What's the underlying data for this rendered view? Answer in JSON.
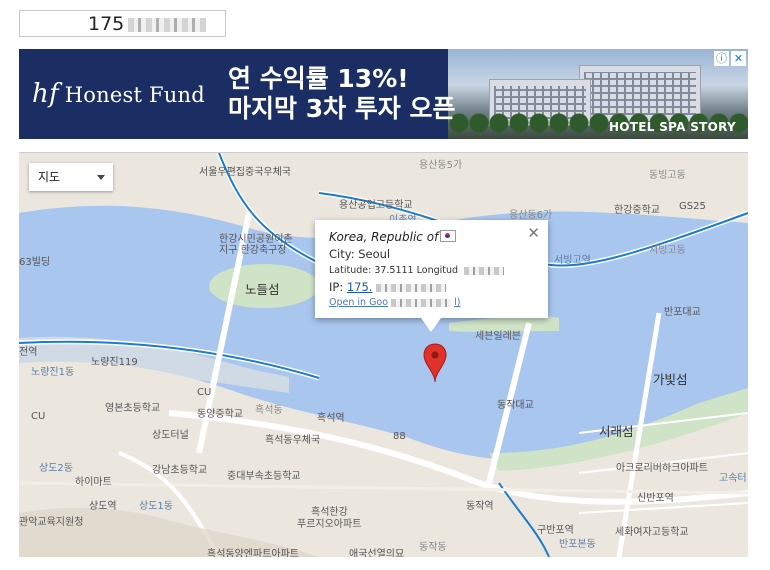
{
  "ip_input": {
    "value": "175",
    "masked_tail": "(blurred)"
  },
  "ad": {
    "brand": "Honest Fund",
    "brand_mark": "hf",
    "headline_line1": "연 수익률 13%!",
    "headline_line2": "마지막 3차 투자 오픈",
    "tagline": "HOTEL SPA STORY",
    "info_icon": "info-icon",
    "close_icon": "close-icon"
  },
  "map": {
    "type_select": "지도",
    "info": {
      "country": "Korea, Republic of",
      "city": "City: Seoul",
      "coords": "Latitude: 37.5111 Longitud",
      "ip_label": "IP:",
      "ip_value": "175.",
      "open_link": "Open in Goo",
      "open_link_tail": "l)"
    },
    "labels": {
      "l1": "서울우편집중국우체국",
      "l2": "용산공업고등학교",
      "l3": "용산동5가",
      "l4": "이촌역",
      "l5": "용산동6가",
      "l6": "동빙고동",
      "l7": "한강중학교",
      "l8": "GS25",
      "l9": "한강시민공원이촌",
      "l10": "지구 한강축구장",
      "l11": "서빙고역",
      "l12": "서빙고동",
      "l13": "63빌딩",
      "l14": "노들섬",
      "l15": "반포대교",
      "l16": "세븐일레븐",
      "l17": "전역",
      "l18": "노량진119",
      "l19": "노량진1동",
      "l20": "가빛섬",
      "l21": "CU",
      "l22": "영본초등학교",
      "l23": "동양중학교",
      "l24": "흑석동",
      "l25": "흑석역",
      "l26": "동작대교",
      "l27": "상도터널",
      "l28": "흑석동우체국",
      "l29": "서래섬",
      "l30": "88",
      "l31": "상도2동",
      "l32": "하이마트",
      "l33": "강남초등학교",
      "l34": "중대부속초등학교",
      "l35": "아크로리버하크아파트",
      "l36": "고속터",
      "l37": "상도역",
      "l38": "상도1동",
      "l39": "신반포역",
      "l40": "관악교육지원청",
      "l41": "흑석한강",
      "l42": "푸르지오아파트",
      "l43": "동작역",
      "l44": "구반포역",
      "l45": "반포본동",
      "l46": "세화여자고등학교",
      "l47": "흑석동양엔파트아파트",
      "l48": "애국선열의묘",
      "l49": "동작동",
      "l50": "CU"
    }
  },
  "colors": {
    "water": "#a8c6ee",
    "land": "#ebe7df",
    "road": "#ffffff",
    "ad_bg": "#1b2e63"
  }
}
